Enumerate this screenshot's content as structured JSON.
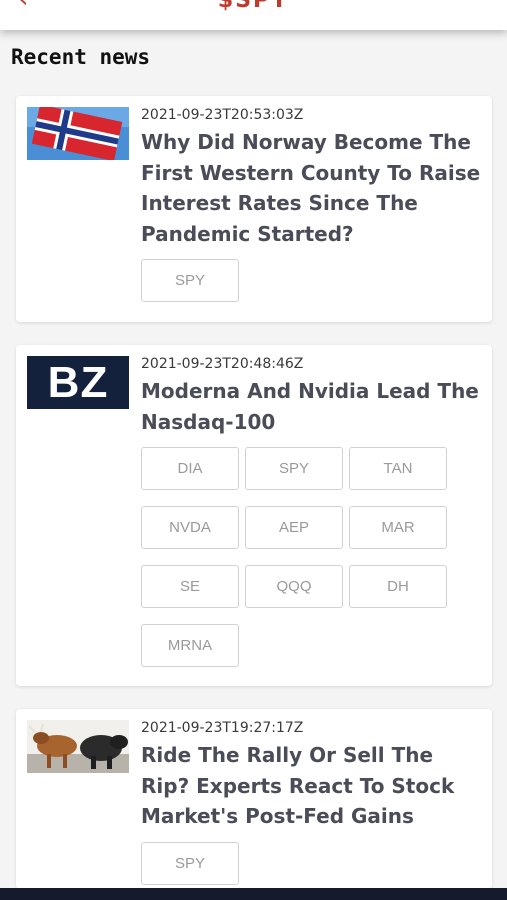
{
  "header": {
    "title": "$SPY",
    "back_icon": "back-chevron-icon",
    "accent": "#c0392b"
  },
  "section_title": "Recent news",
  "news": [
    {
      "date": "2021-09-23T20:53:03Z",
      "headline": "Why Did Norway Become The First Western County To Raise Interest Rates Since The Pandemic Started?",
      "image": "norway-flag-image",
      "tickers": [
        "SPY"
      ]
    },
    {
      "date": "2021-09-23T20:48:46Z",
      "headline": "Moderna And Nvidia Lead The Nasdaq-100",
      "image": "benzinga-logo-image",
      "image_text": "BZ",
      "tickers": [
        "DIA",
        "SPY",
        "TAN",
        "NVDA",
        "AEP",
        "MAR",
        "SE",
        "QQQ",
        "DH",
        "MRNA"
      ]
    },
    {
      "date": "2021-09-23T19:27:17Z",
      "headline": "Ride The Rally Or Sell The Rip? Experts React To Stock Market's Post-Fed Gains",
      "image": "bull-bear-image",
      "tickers": [
        "SPY"
      ]
    }
  ],
  "colors": {
    "headline": "#4a4d57",
    "ticker_border": "#d2d2d2",
    "bottom_bar": "#151a2c"
  }
}
